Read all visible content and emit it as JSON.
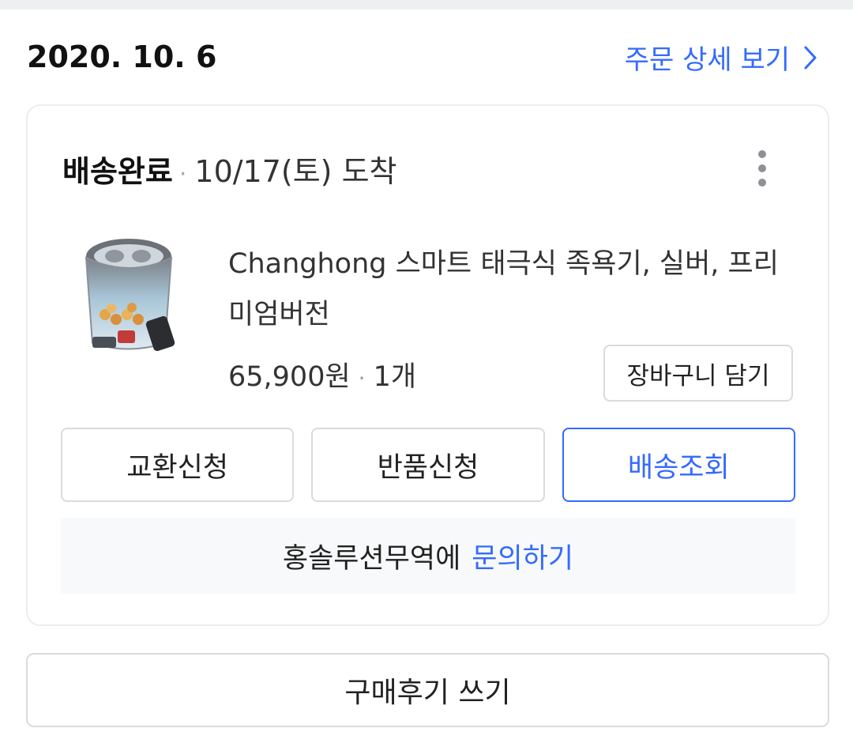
{
  "order": {
    "date": "2020. 10. 6",
    "detail_link": "주문 상세 보기"
  },
  "delivery": {
    "status": "배송완료",
    "arrival": "10/17(토) 도착",
    "product": {
      "name": "Changhong 스마트 태극식 족욕기, 실버, 프리미엄버전",
      "price": "65,900원",
      "quantity": "1개"
    },
    "cart_button": "장바구니 담기",
    "actions": [
      {
        "label": "교환신청"
      },
      {
        "label": "반품신청"
      },
      {
        "label": "배송조회"
      }
    ],
    "inquiry": {
      "seller_text": "홍솔루션무역에",
      "link": "문의하기"
    }
  },
  "review_button": "구매후기 쓰기",
  "icons": {
    "detail_chevron": "chevron-right-icon",
    "menu": "more-vertical-icon"
  },
  "colors": {
    "accent": "#346aff",
    "border": "#d9dbde",
    "inquiry_bg": "#f8f9fa"
  }
}
